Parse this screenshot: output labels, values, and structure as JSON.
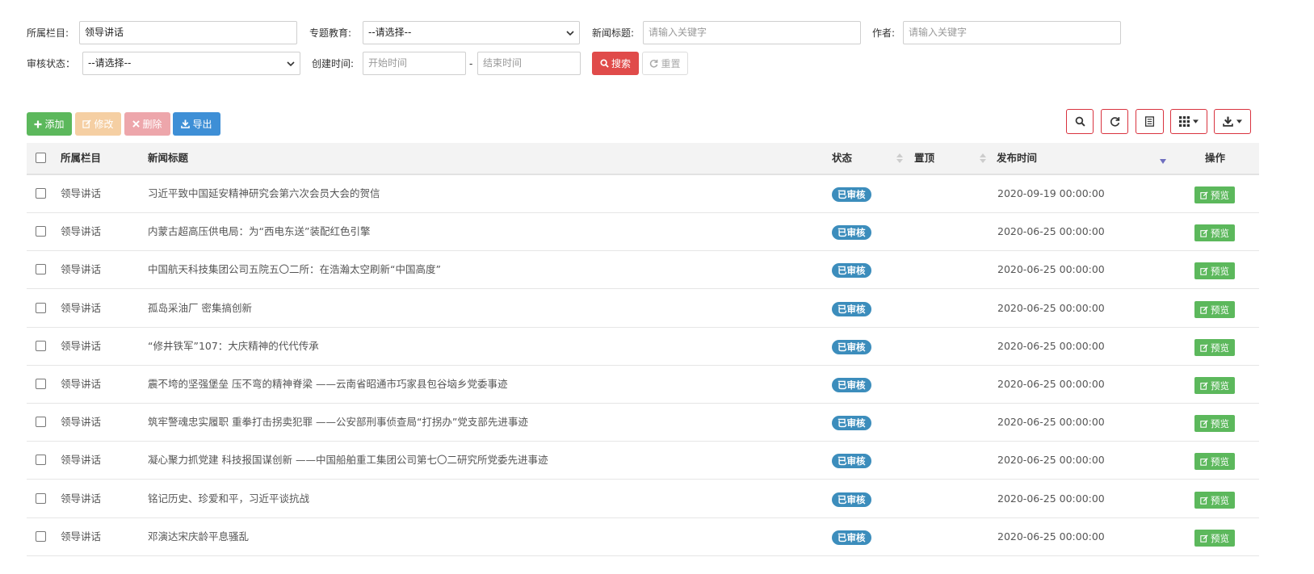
{
  "filters": {
    "column": {
      "label": "所属栏目:",
      "value": "领导讲话"
    },
    "topic": {
      "label": "专题教育:",
      "value": "--请选择--"
    },
    "news_title": {
      "label": "新闻标题:",
      "placeholder": "请输入关键字"
    },
    "author": {
      "label": "作者:",
      "placeholder": "请输入关键字"
    },
    "review_status": {
      "label": "审核状态：",
      "value": "--请选择--"
    },
    "created_time": {
      "label": "创建时间:",
      "start_placeholder": "开始时间",
      "separator": "-",
      "end_placeholder": "结束时间"
    },
    "search_label": "搜索",
    "reset_label": "重置"
  },
  "toolbar": {
    "add_label": "添加",
    "edit_label": "修改",
    "delete_label": "删除",
    "export_label": "导出"
  },
  "table": {
    "headers": {
      "column": "所属栏目",
      "title": "新闻标题",
      "status": "状态",
      "pinned": "置顶",
      "publish_time": "发布时间",
      "actions": "操作"
    },
    "sort": {
      "column": "publish_time",
      "direction": "desc"
    },
    "preview_label": "预览",
    "rows": [
      {
        "column": "领导讲话",
        "title": "习近平致中国延安精神研究会第六次会员大会的贺信",
        "status": "已审核",
        "pinned": "",
        "time": "2020-09-19 00:00:00"
      },
      {
        "column": "领导讲话",
        "title": "内蒙古超高压供电局：为“西电东送”装配红色引擎",
        "status": "已审核",
        "pinned": "",
        "time": "2020-06-25 00:00:00"
      },
      {
        "column": "领导讲话",
        "title": "中国航天科技集团公司五院五〇二所：在浩瀚太空刷新“中国高度”",
        "status": "已审核",
        "pinned": "",
        "time": "2020-06-25 00:00:00"
      },
      {
        "column": "领导讲话",
        "title": "孤岛采油厂 密集搞创新",
        "status": "已审核",
        "pinned": "",
        "time": "2020-06-25 00:00:00"
      },
      {
        "column": "领导讲话",
        "title": "“修井铁军”107：大庆精神的代代传承",
        "status": "已审核",
        "pinned": "",
        "time": "2020-06-25 00:00:00"
      },
      {
        "column": "领导讲话",
        "title": "震不垮的坚强堡垒 压不弯的精神脊梁 ——云南省昭通市巧家县包谷垴乡党委事迹",
        "status": "已审核",
        "pinned": "",
        "time": "2020-06-25 00:00:00"
      },
      {
        "column": "领导讲话",
        "title": "筑牢警魂忠实履职 重拳打击拐卖犯罪 ——公安部刑事侦查局“打拐办”党支部先进事迹",
        "status": "已审核",
        "pinned": "",
        "time": "2020-06-25 00:00:00"
      },
      {
        "column": "领导讲话",
        "title": "凝心聚力抓党建 科技报国谋创新 ——中国船舶重工集团公司第七〇二研究所党委先进事迹",
        "status": "已审核",
        "pinned": "",
        "time": "2020-06-25 00:00:00"
      },
      {
        "column": "领导讲话",
        "title": "铭记历史、珍爱和平，习近平谈抗战",
        "status": "已审核",
        "pinned": "",
        "time": "2020-06-25 00:00:00"
      },
      {
        "column": "领导讲话",
        "title": "邓演达宋庆龄平息骚乱",
        "status": "已审核",
        "pinned": "",
        "time": "2020-06-25 00:00:00"
      }
    ]
  },
  "icons": {
    "search": "search-icon",
    "reset": "refresh-icon",
    "add": "plus-icon",
    "edit": "edit-icon",
    "delete": "close-icon",
    "export": "download-icon",
    "toggle_columns": "list-icon",
    "grid": "grid-icon",
    "preview": "edit-icon"
  },
  "colors": {
    "primary_blue": "#3e8fd6",
    "danger_red": "#e04b4a",
    "success_green": "#5cb85c",
    "status_badge": "#3c8dbc",
    "tool_border": "#d9333f"
  }
}
